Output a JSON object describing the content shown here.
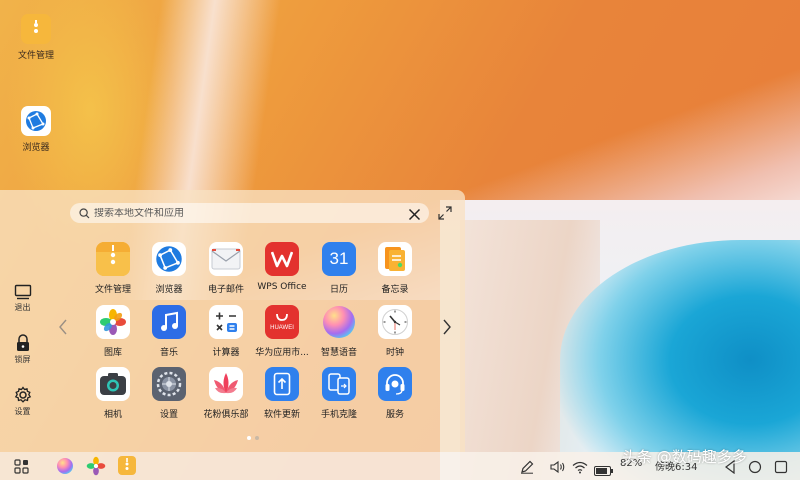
{
  "desktop": {
    "icons": [
      {
        "label": "文件管理",
        "icon": "file-manager-icon"
      },
      {
        "label": "浏览器",
        "icon": "browser-icon"
      }
    ]
  },
  "launcher": {
    "search_placeholder": "搜索本地文件和应用",
    "rail": [
      {
        "label": "退出",
        "icon": "exit-icon"
      },
      {
        "label": "锁屏",
        "icon": "lock-icon"
      },
      {
        "label": "设置",
        "icon": "gear-icon"
      }
    ],
    "apps": [
      {
        "label": "文件管理",
        "icon": "file-manager-icon"
      },
      {
        "label": "浏览器",
        "icon": "browser-icon"
      },
      {
        "label": "电子邮件",
        "icon": "email-icon"
      },
      {
        "label": "WPS Office",
        "icon": "wps-office-icon"
      },
      {
        "label": "日历",
        "icon": "calendar-icon",
        "badge": "31"
      },
      {
        "label": "备忘录",
        "icon": "notes-icon"
      },
      {
        "label": "图库",
        "icon": "gallery-icon"
      },
      {
        "label": "音乐",
        "icon": "music-icon"
      },
      {
        "label": "计算器",
        "icon": "calculator-icon"
      },
      {
        "label": "华为应用市...",
        "icon": "huawei-appgallery-icon",
        "badge": "HUAWEI"
      },
      {
        "label": "智慧语音",
        "icon": "voice-assistant-icon"
      },
      {
        "label": "时钟",
        "icon": "clock-icon"
      },
      {
        "label": "相机",
        "icon": "camera-icon"
      },
      {
        "label": "设置",
        "icon": "settings-icon"
      },
      {
        "label": "花粉俱乐部",
        "icon": "huafen-club-icon"
      },
      {
        "label": "软件更新",
        "icon": "software-update-icon"
      },
      {
        "label": "手机克隆",
        "icon": "phone-clone-icon"
      },
      {
        "label": "服务",
        "icon": "service-icon"
      }
    ],
    "page_count": 2,
    "active_page": 1
  },
  "taskbar": {
    "battery_percent": "82%",
    "time": "傍晚6:34"
  },
  "watermark": "头条 @数码趣多多",
  "colors": {
    "panel": "#f8e2c3",
    "accent_blue": "#2f80ed",
    "folder_yellow": "#f6b73c"
  }
}
